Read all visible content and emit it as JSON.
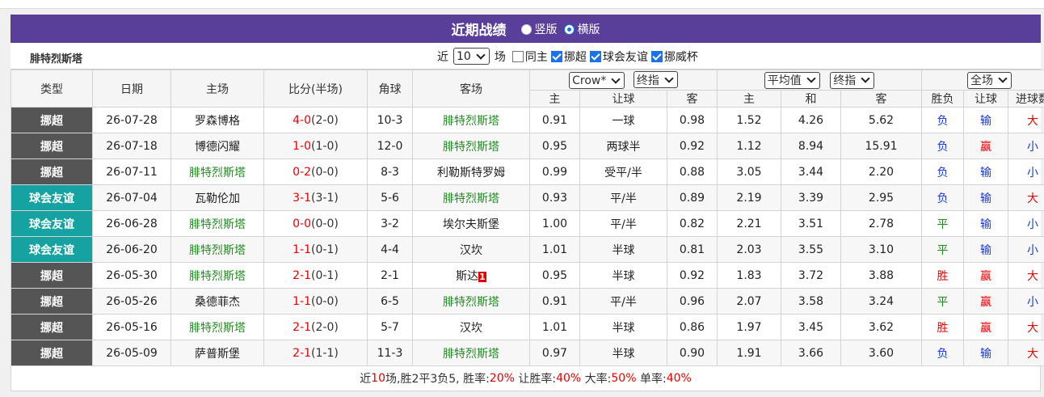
{
  "header": {
    "title": "近期战绩",
    "options": [
      "竖版",
      "横版"
    ],
    "selected": "横版"
  },
  "team": "腓特烈斯塔",
  "filters": {
    "prefix": "近",
    "count": "10",
    "suffix": "场",
    "checks": [
      {
        "label": "同主",
        "checked": false
      },
      {
        "label": "挪超",
        "checked": true
      },
      {
        "label": "球会友谊",
        "checked": true
      },
      {
        "label": "挪威杯",
        "checked": true
      }
    ]
  },
  "columns": {
    "type": "类型",
    "date": "日期",
    "home": "主场",
    "score": "比分(半场)",
    "corner": "角球",
    "away": "客场"
  },
  "odds_group_a": {
    "company": "Crow*",
    "mode": "终指",
    "sub": [
      "主",
      "让球",
      "客"
    ]
  },
  "odds_group_b": {
    "company": "平均值",
    "mode": "终指",
    "sub": [
      "主",
      "和",
      "客"
    ]
  },
  "result_group": {
    "scope": "全场",
    "sub": [
      "胜负",
      "让球",
      "进球数"
    ]
  },
  "rows": [
    {
      "type": "挪超",
      "kind": "league",
      "date": "26-07-28",
      "home": "罗森博格",
      "home_green": false,
      "score": "4-0",
      "ht": "(2-0)",
      "corner": "10-3",
      "away": "腓特烈斯塔",
      "away_green": true,
      "away_badge": "",
      "a1": "0.91",
      "a2": "一球",
      "a3": "0.98",
      "b1": "1.52",
      "b2": "4.26",
      "b3": "5.62",
      "wl": "负",
      "wl_c": "blue",
      "hc": "输",
      "hc_c": "blue",
      "goals": "大",
      "goals_c": "red"
    },
    {
      "type": "挪超",
      "kind": "league",
      "date": "26-07-18",
      "home": "博德闪耀",
      "home_green": false,
      "score": "1-0",
      "ht": "(1-0)",
      "corner": "12-0",
      "away": "腓特烈斯塔",
      "away_green": true,
      "away_badge": "",
      "a1": "0.95",
      "a2": "两球半",
      "a3": "0.92",
      "b1": "1.12",
      "b2": "8.94",
      "b3": "15.91",
      "wl": "负",
      "wl_c": "blue",
      "hc": "赢",
      "hc_c": "red",
      "goals": "小",
      "goals_c": "blue"
    },
    {
      "type": "挪超",
      "kind": "league",
      "date": "26-07-11",
      "home": "腓特烈斯塔",
      "home_green": true,
      "score": "0-2",
      "ht": "(0-0)",
      "corner": "8-3",
      "away": "利勒斯特罗姆",
      "away_green": false,
      "away_badge": "",
      "a1": "0.99",
      "a2": "受平/半",
      "a3": "0.88",
      "b1": "3.05",
      "b2": "3.44",
      "b3": "2.20",
      "wl": "负",
      "wl_c": "blue",
      "hc": "输",
      "hc_c": "blue",
      "goals": "小",
      "goals_c": "blue"
    },
    {
      "type": "球会友谊",
      "kind": "friendly",
      "date": "26-07-04",
      "home": "瓦勒伦加",
      "home_green": false,
      "score": "3-1",
      "ht": "(3-1)",
      "corner": "5-6",
      "away": "腓特烈斯塔",
      "away_green": true,
      "away_badge": "",
      "a1": "0.93",
      "a2": "平/半",
      "a3": "0.89",
      "b1": "2.19",
      "b2": "3.39",
      "b3": "2.95",
      "wl": "负",
      "wl_c": "blue",
      "hc": "输",
      "hc_c": "blue",
      "goals": "大",
      "goals_c": "red"
    },
    {
      "type": "球会友谊",
      "kind": "friendly",
      "date": "26-06-28",
      "home": "腓特烈斯塔",
      "home_green": true,
      "score": "0-0",
      "ht": "(0-0)",
      "corner": "3-2",
      "away": "埃尔夫斯堡",
      "away_green": false,
      "away_badge": "",
      "a1": "1.00",
      "a2": "平/半",
      "a3": "0.82",
      "b1": "2.21",
      "b2": "3.51",
      "b3": "2.78",
      "wl": "平",
      "wl_c": "green",
      "hc": "输",
      "hc_c": "blue",
      "goals": "小",
      "goals_c": "blue"
    },
    {
      "type": "球会友谊",
      "kind": "friendly",
      "date": "26-06-20",
      "home": "腓特烈斯塔",
      "home_green": true,
      "score": "1-1",
      "ht": "(0-1)",
      "corner": "4-4",
      "away": "汉坎",
      "away_green": false,
      "away_badge": "",
      "a1": "1.01",
      "a2": "半球",
      "a3": "0.81",
      "b1": "2.03",
      "b2": "3.55",
      "b3": "3.10",
      "wl": "平",
      "wl_c": "green",
      "hc": "输",
      "hc_c": "blue",
      "goals": "小",
      "goals_c": "blue"
    },
    {
      "type": "挪超",
      "kind": "league",
      "date": "26-05-30",
      "home": "腓特烈斯塔",
      "home_green": true,
      "score": "2-1",
      "ht": "(0-1)",
      "corner": "2-1",
      "away": "斯达",
      "away_green": false,
      "away_badge": "1",
      "a1": "0.95",
      "a2": "半球",
      "a3": "0.92",
      "b1": "1.83",
      "b2": "3.72",
      "b3": "3.88",
      "wl": "胜",
      "wl_c": "red",
      "hc": "赢",
      "hc_c": "red",
      "goals": "大",
      "goals_c": "red"
    },
    {
      "type": "挪超",
      "kind": "league",
      "date": "26-05-26",
      "home": "桑德菲杰",
      "home_green": false,
      "score": "1-1",
      "ht": "(0-0)",
      "corner": "6-5",
      "away": "腓特烈斯塔",
      "away_green": true,
      "away_badge": "",
      "a1": "0.91",
      "a2": "平/半",
      "a3": "0.96",
      "b1": "2.07",
      "b2": "3.58",
      "b3": "3.24",
      "wl": "平",
      "wl_c": "green",
      "hc": "赢",
      "hc_c": "red",
      "goals": "小",
      "goals_c": "blue"
    },
    {
      "type": "挪超",
      "kind": "league",
      "date": "26-05-16",
      "home": "腓特烈斯塔",
      "home_green": true,
      "score": "2-1",
      "ht": "(2-0)",
      "corner": "5-7",
      "away": "汉坎",
      "away_green": false,
      "away_badge": "",
      "a1": "1.01",
      "a2": "半球",
      "a3": "0.86",
      "b1": "1.97",
      "b2": "3.45",
      "b3": "3.62",
      "wl": "胜",
      "wl_c": "red",
      "hc": "赢",
      "hc_c": "red",
      "goals": "大",
      "goals_c": "red"
    },
    {
      "type": "挪超",
      "kind": "league",
      "date": "26-05-09",
      "home": "萨普斯堡",
      "home_green": false,
      "score": "2-1",
      "ht": "(1-1)",
      "corner": "11-3",
      "away": "腓特烈斯塔",
      "away_green": true,
      "away_badge": "",
      "a1": "0.97",
      "a2": "半球",
      "a3": "0.90",
      "b1": "1.91",
      "b2": "3.66",
      "b3": "3.60",
      "wl": "负",
      "wl_c": "blue",
      "hc": "输",
      "hc_c": "blue",
      "goals": "大",
      "goals_c": "red"
    }
  ],
  "summary": {
    "prefix": "近",
    "games": "10",
    "mid": "场,胜2平3负5, 胜率:",
    "win_rate": "20%",
    "hc_label": " 让胜率:",
    "hc_rate": "40%",
    "big_label": " 大率:",
    "big_rate": "50%",
    "odd_label": " 单率:",
    "odd_rate": "40%"
  },
  "colors": {
    "title_bg": "#5a3f9a",
    "league": "#555555",
    "friendly": "#17a2a2",
    "green": "#228b22",
    "red": "#e60000",
    "blue": "#1a3ad9"
  }
}
